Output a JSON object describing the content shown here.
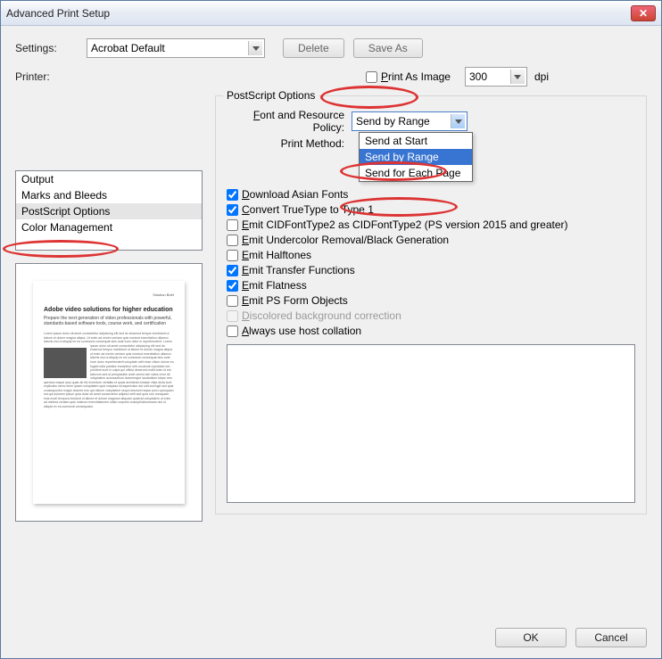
{
  "window": {
    "title": "Advanced Print Setup"
  },
  "settings": {
    "label": "Settings:",
    "value": "Acrobat Default",
    "delete": "Delete",
    "save_as": "Save As"
  },
  "printer": {
    "label": "Printer:",
    "print_as_image": "Print As Image",
    "dpi_value": "300",
    "dpi_label": "dpi"
  },
  "sidebar": {
    "items": [
      "Output",
      "Marks and Bleeds",
      "PostScript Options",
      "Color Management"
    ],
    "selected": 2
  },
  "postscript": {
    "group_label": "PostScript Options",
    "font_policy_label": "Font and Resource Policy:",
    "font_policy_value": "Send by Range",
    "font_policy_options": [
      "Send at Start",
      "Send by Range",
      "Send for Each Page"
    ],
    "print_method_label": "Print Method:",
    "checks": [
      {
        "label": "Download Asian Fonts",
        "checked": true,
        "disabled": false
      },
      {
        "label": "Convert TrueType to Type 1",
        "checked": true,
        "disabled": false
      },
      {
        "label": "Emit CIDFontType2 as CIDFontType2 (PS version 2015 and greater)",
        "checked": false,
        "disabled": false
      },
      {
        "label": "Emit Undercolor Removal/Black Generation",
        "checked": false,
        "disabled": false
      },
      {
        "label": "Emit Halftones",
        "checked": false,
        "disabled": false
      },
      {
        "label": "Emit Transfer Functions",
        "checked": true,
        "disabled": false
      },
      {
        "label": "Emit Flatness",
        "checked": true,
        "disabled": false
      },
      {
        "label": "Emit PS Form Objects",
        "checked": false,
        "disabled": false
      },
      {
        "label": "Discolored background correction",
        "checked": false,
        "disabled": true
      },
      {
        "label": "Always use host collation",
        "checked": false,
        "disabled": false
      }
    ]
  },
  "preview": {
    "title": "Adobe video solutions for higher education",
    "subtitle": "Prepare the next generation of video professionals with powerful, standards-based software tools, course work, and certification"
  },
  "footer": {
    "ok": "OK",
    "cancel": "Cancel"
  }
}
